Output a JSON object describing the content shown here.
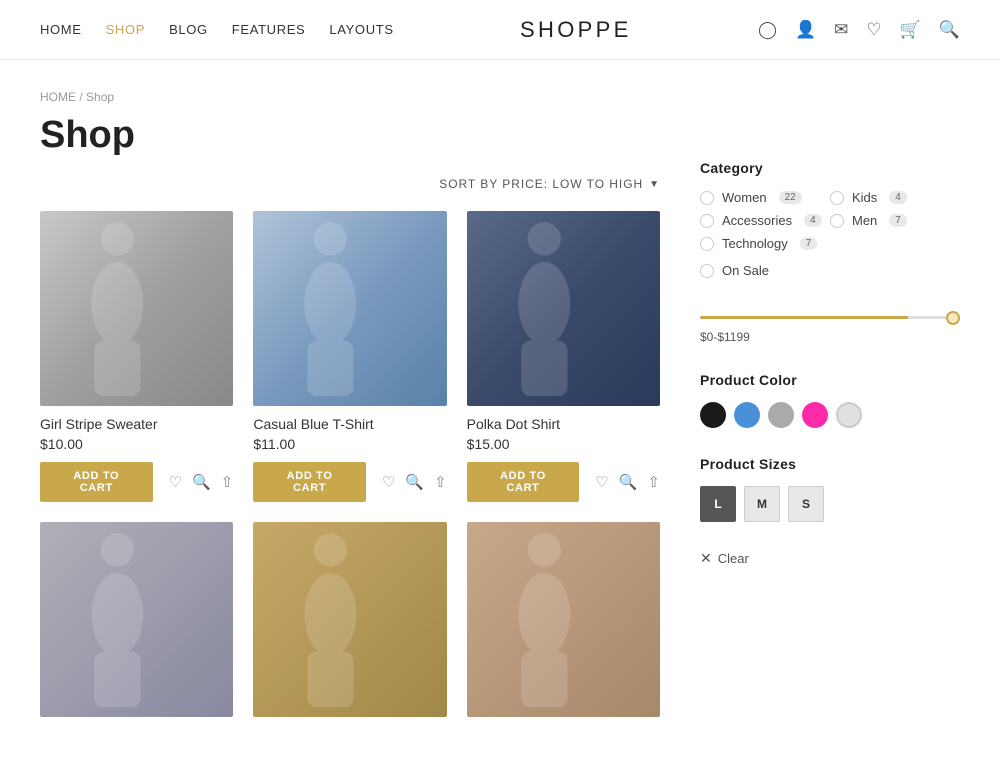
{
  "navbar": {
    "logo": "SHOPPE",
    "links": [
      {
        "label": "HOME",
        "active": false
      },
      {
        "label": "SHOP",
        "active": true
      },
      {
        "label": "BLOG",
        "active": false
      },
      {
        "label": "FEATURES",
        "active": false
      },
      {
        "label": "LAYOUTS",
        "active": false
      }
    ],
    "icons": [
      "location-icon",
      "user-icon",
      "mail-icon",
      "heart-icon",
      "cart-icon",
      "search-icon"
    ]
  },
  "breadcrumb": {
    "home": "HOME",
    "separator": "/",
    "current": "Shop"
  },
  "page_title": "Shop",
  "sort_label": "SORT BY PRICE: LOW TO HIGH",
  "products": [
    {
      "name": "Girl Stripe Sweater",
      "price": "$10.00",
      "img_class": "img-sweater"
    },
    {
      "name": "Casual Blue T-Shirt",
      "price": "$11.00",
      "img_class": "img-tshirt"
    },
    {
      "name": "Polka Dot Shirt",
      "price": "$15.00",
      "img_class": "img-shirt"
    },
    {
      "name": "",
      "price": "",
      "img_class": "img-bottom1"
    },
    {
      "name": "",
      "price": "",
      "img_class": "img-bottom2"
    },
    {
      "name": "",
      "price": "",
      "img_class": "img-bottom3"
    }
  ],
  "add_to_cart_label": "ADD TO CART",
  "sidebar": {
    "category_title": "Category",
    "categories": [
      {
        "label": "Women",
        "count": "22"
      },
      {
        "label": "Kids",
        "count": "4"
      },
      {
        "label": "Accessories",
        "count": "4"
      },
      {
        "label": "Men",
        "count": "7"
      },
      {
        "label": "Technology",
        "count": "7"
      }
    ],
    "on_sale_label": "On Sale",
    "price_range": "$0-$1199",
    "product_color_title": "Product Color",
    "colors": [
      {
        "name": "black",
        "hex": "#1a1a1a"
      },
      {
        "name": "blue",
        "hex": "#4a90d9"
      },
      {
        "name": "gray",
        "hex": "#aaaaaa"
      },
      {
        "name": "pink",
        "hex": "#ff2aaa"
      },
      {
        "name": "light-gray",
        "hex": "#e0e0e0"
      }
    ],
    "product_sizes_title": "Product Sizes",
    "sizes": [
      "L",
      "M",
      "S"
    ],
    "active_size": "L",
    "clear_label": "Clear"
  }
}
